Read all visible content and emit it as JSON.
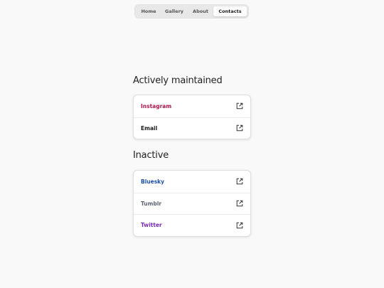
{
  "nav": {
    "items": [
      {
        "label": "Home"
      },
      {
        "label": "Gallery"
      },
      {
        "label": "About"
      },
      {
        "label": "Contacts",
        "active": true
      }
    ]
  },
  "sections": [
    {
      "title": "Actively maintained",
      "links": [
        {
          "label": "Instagram",
          "color": "#b0184e",
          "icon": "external-link-icon"
        },
        {
          "label": "Email",
          "color": "#1a1a1a",
          "icon": "external-link-icon"
        }
      ]
    },
    {
      "title": "Inactive",
      "links": [
        {
          "label": "Bluesky",
          "color": "#1d4fa6",
          "icon": "external-link-icon"
        },
        {
          "label": "Tumblr",
          "color": "#5c6470",
          "icon": "external-link-icon"
        },
        {
          "label": "Twitter",
          "color": "#7a2bb0",
          "icon": "external-link-icon"
        }
      ]
    }
  ]
}
